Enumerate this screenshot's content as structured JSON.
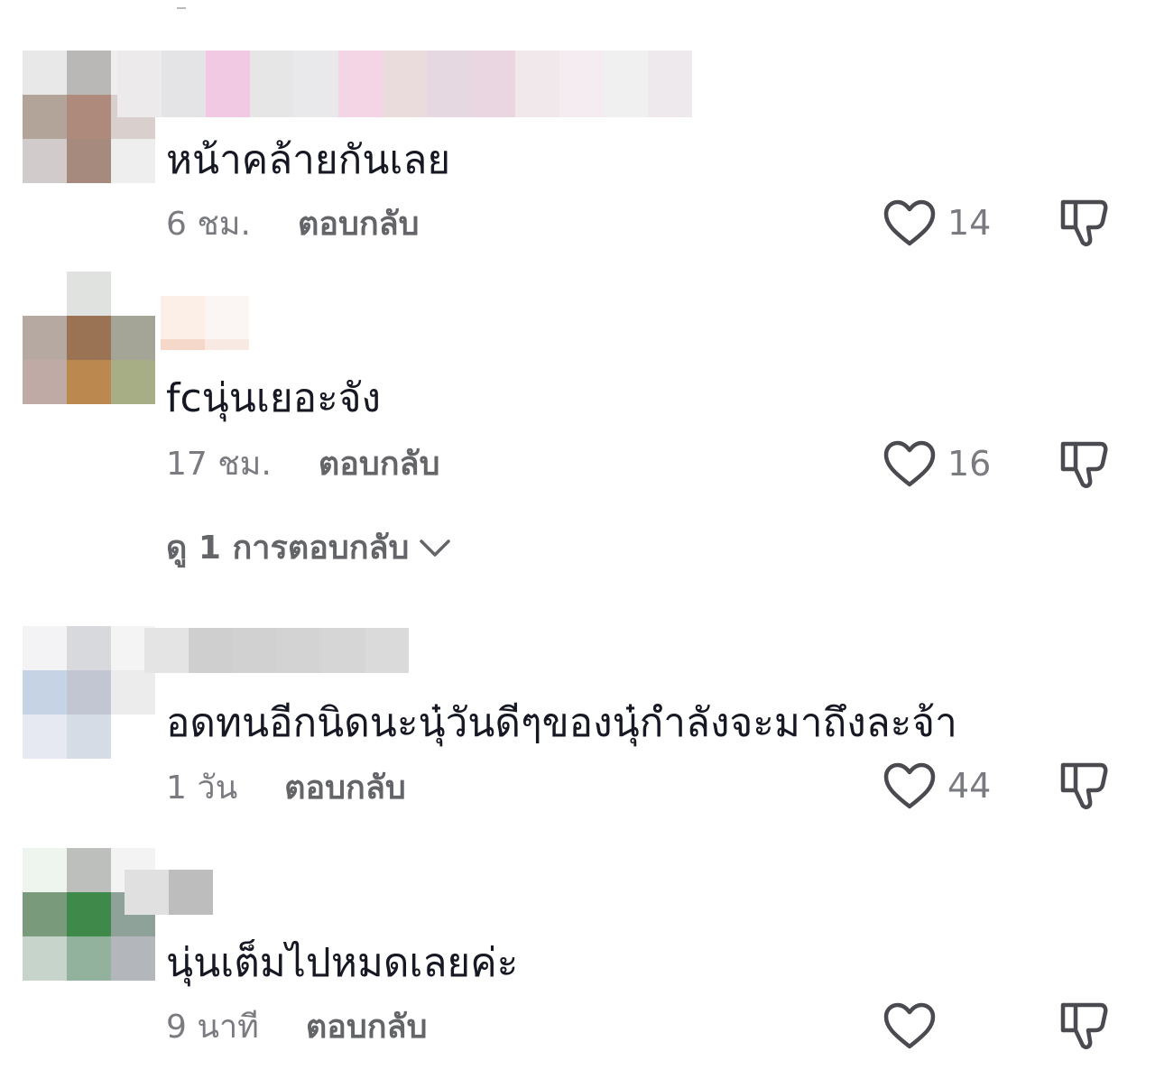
{
  "comments": [
    {
      "text": "หน้าคล้ายกันเลย",
      "time": "6 ชม.",
      "reply_label": "ตอบกลับ",
      "likes": "14"
    },
    {
      "text": "fcนุ่นเยอะจัง",
      "time": "17 ชม.",
      "reply_label": "ตอบกลับ",
      "likes": "16",
      "view_replies": "ดู 1 การตอบกลับ"
    },
    {
      "text": "อดทนอีกนิดนะนุ๋วันดีๆของนุ๋กำลังจะมาถึงละจ้า",
      "time": "1 วัน",
      "reply_label": "ตอบกลับ",
      "likes": "44"
    },
    {
      "text": "นุ่นเต็มไปหมดเลยค่ะ",
      "time": "9 นาที",
      "reply_label": "ตอบกลับ",
      "likes": ""
    }
  ],
  "icons": {
    "like": "heart-outline-icon",
    "dislike": "thumbs-down-icon",
    "expand": "chevron-down-icon"
  },
  "colors": {
    "text": "#161823",
    "secondary": "#7a7b80",
    "icon": "#4a4b50"
  }
}
